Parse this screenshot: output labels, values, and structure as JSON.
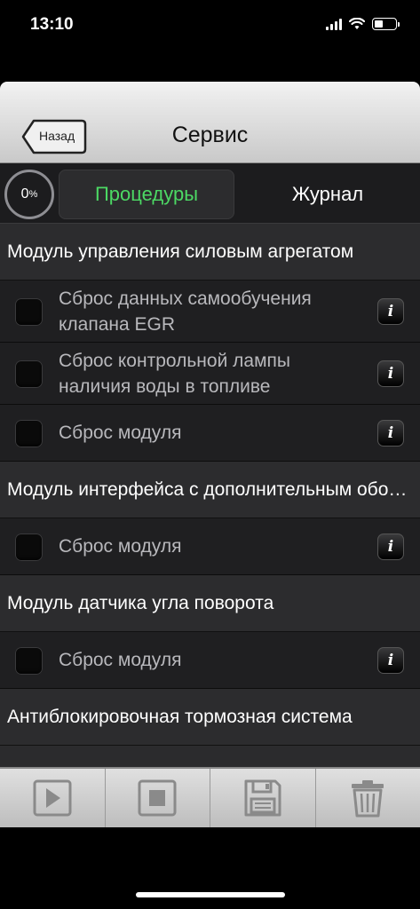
{
  "status_bar": {
    "time": "13:10"
  },
  "nav": {
    "back_label": "Назад",
    "title": "Сервис"
  },
  "progress": {
    "value": "0",
    "unit": "%"
  },
  "tabs": {
    "procedures": "Процедуры",
    "journal": "Журнал",
    "active": "procedures",
    "active_color": "#4cd964"
  },
  "sections": [
    {
      "title": "Модуль управления силовым агрегатом",
      "items": [
        {
          "label": "Сброс данных самообучения клапана EGR",
          "checked": false
        },
        {
          "label": "Сброс контрольной лампы наличия воды в топливе",
          "checked": false
        },
        {
          "label": "Сброс модуля",
          "checked": false
        }
      ]
    },
    {
      "title": "Модуль интерфейса с дополнительным оборудованием",
      "items": [
        {
          "label": "Сброс модуля",
          "checked": false
        }
      ]
    },
    {
      "title": "Модуль датчика угла поворота",
      "items": [
        {
          "label": "Сброс модуля",
          "checked": false
        }
      ]
    },
    {
      "title": "Антиблокировочная тормозная система",
      "items": []
    }
  ],
  "toolbar": {
    "buttons": [
      "play-icon",
      "stop-icon",
      "save-icon",
      "trash-icon"
    ]
  }
}
